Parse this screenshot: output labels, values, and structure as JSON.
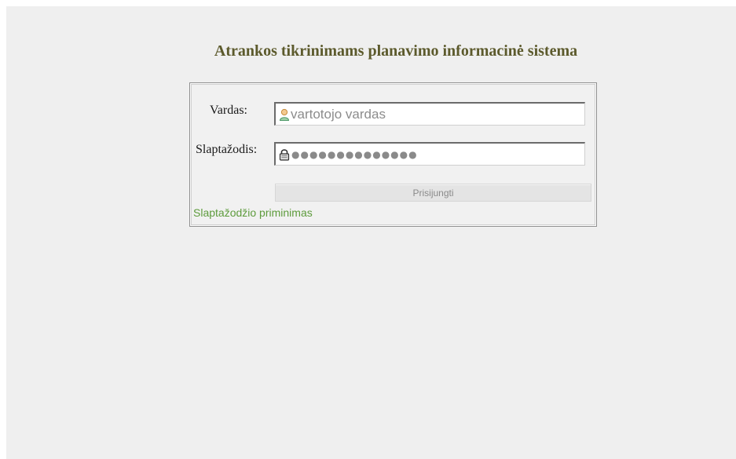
{
  "header": {
    "title": "Atrankos tikrinimams planavimo informacinė sistema"
  },
  "login": {
    "username_label": "Vardas:",
    "username_placeholder": "vartotojo vardas",
    "username_icon": "user-icon",
    "password_label": "Slaptažodis:",
    "password_masked": "●●●●●●●●●●●●●●",
    "password_icon": "lock-icon",
    "submit_label": "Prisijungti",
    "reminder_link": "Slaptažodžio priminimas"
  },
  "colors": {
    "background": "#efefef",
    "title": "#5c5a2c",
    "link": "#5d9b3c"
  }
}
